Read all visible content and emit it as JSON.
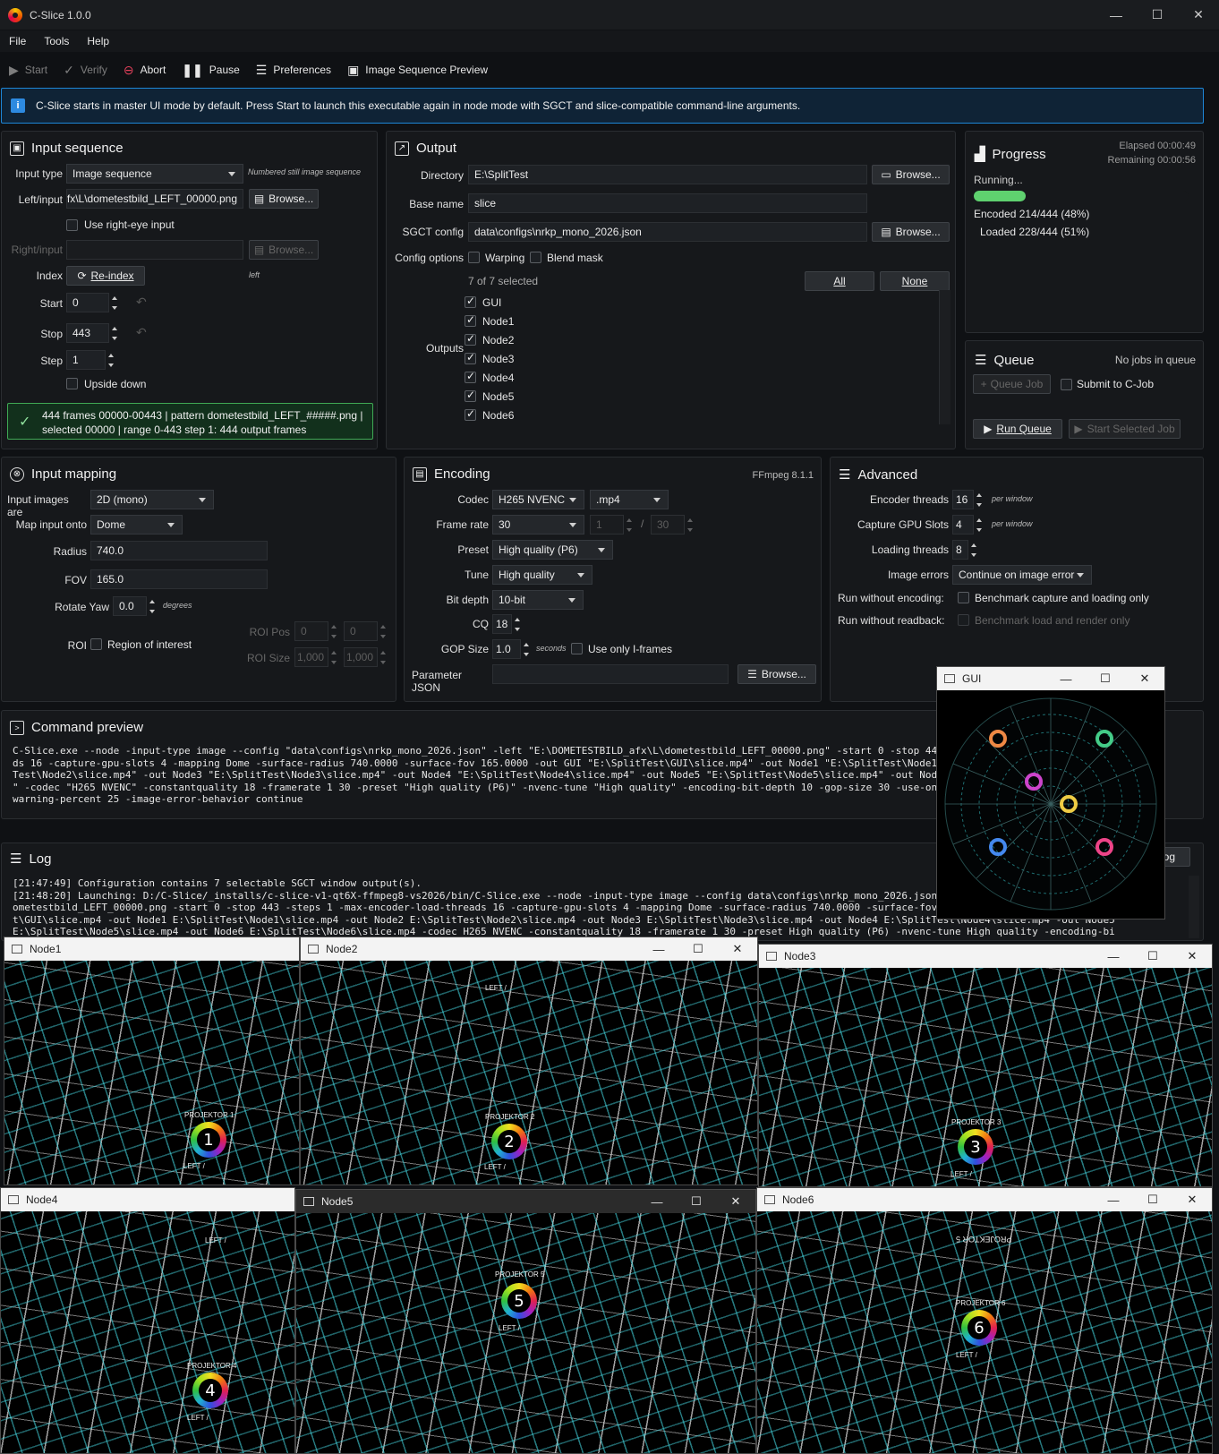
{
  "app": {
    "title": "C-Slice 1.0.0"
  },
  "menu": [
    "File",
    "Tools",
    "Help"
  ],
  "toolbar": {
    "start": "Start",
    "verify": "Verify",
    "abort": "Abort",
    "pause": "Pause",
    "preferences": "Preferences",
    "preview": "Image Sequence Preview"
  },
  "info": "C-Slice starts in master UI mode by default. Press Start to launch this executable again in node mode with SGCT and slice-compatible command-line arguments.",
  "input": {
    "title": "Input sequence",
    "input_type_label": "Input type",
    "input_type": "Image sequence",
    "input_type_hint": "Numbered still image sequence",
    "left_label": "Left/input",
    "left_value": "afx\\L\\dometestbild_LEFT_00000.png",
    "browse": "Browse...",
    "use_right_eye": "Use right-eye input",
    "right_label": "Right/input",
    "index_label": "Index",
    "reindex": "Re-index",
    "index_hint": "left",
    "start_label": "Start",
    "start_value": "0",
    "stop_label": "Stop",
    "stop_value": "443",
    "step_label": "Step",
    "step_value": "1",
    "upside_down": "Upside down",
    "status_line1": "444 frames 00000-00443 | pattern dometestbild_LEFT_#####.png |",
    "status_line2": "selected 00000 | range 0-443 step 1: 444 output frames"
  },
  "output": {
    "title": "Output",
    "directory_label": "Directory",
    "directory": "E:\\SplitTest",
    "basename_label": "Base name",
    "basename": "slice",
    "sgct_label": "SGCT config",
    "sgct": "data\\configs\\nrkp_mono_2026.json",
    "browse": "Browse...",
    "config_options_label": "Config options",
    "warping": "Warping",
    "blend_mask": "Blend mask",
    "selected_count": "7 of 7 selected",
    "all": "All",
    "none": "None",
    "outputs_label": "Outputs",
    "outputs": [
      "GUI",
      "Node1",
      "Node2",
      "Node3",
      "Node4",
      "Node5",
      "Node6"
    ]
  },
  "progress": {
    "title": "Progress",
    "elapsed": "Elapsed 00:00:49",
    "remaining": "Remaining 00:00:56",
    "status": "Running...",
    "percent": 48,
    "encoded": "Encoded 214/444 (48%)",
    "loaded": "Loaded 228/444 (51%)",
    "bar_color": "#5fd16f"
  },
  "queue": {
    "title": "Queue",
    "status": "No jobs in queue",
    "queue_job": "Queue Job",
    "submit": "Submit to C-Job",
    "run": "Run Queue",
    "start_selected": "Start Selected Job"
  },
  "mapping": {
    "title": "Input mapping",
    "images_label": "Input images are",
    "images": "2D (mono)",
    "map_label": "Map input onto",
    "map": "Dome",
    "radius_label": "Radius",
    "radius": "740.0",
    "fov_label": "FOV",
    "fov": "165.0",
    "yaw_label": "Rotate Yaw",
    "yaw": "0.0",
    "yaw_unit": "degrees",
    "roi_label": "ROI",
    "roi_check": "Region of interest",
    "roi_pos_label": "ROI Pos",
    "roi_pos_x": "0",
    "roi_pos_y": "0",
    "roi_size_label": "ROI Size",
    "roi_size_w": "1,000",
    "roi_size_h": "1,000"
  },
  "encoding": {
    "title": "Encoding",
    "version": "FFmpeg 8.1.1",
    "codec_label": "Codec",
    "codec": "H265 NVENC",
    "container": ".mp4",
    "framerate_label": "Frame rate",
    "framerate": "30",
    "fr_num": "1",
    "fr_sep": "/",
    "fr_den": "30",
    "preset_label": "Preset",
    "preset": "High quality (P6)",
    "tune_label": "Tune",
    "tune": "High quality",
    "bitdepth_label": "Bit depth",
    "bitdepth": "10-bit",
    "cq_label": "CQ",
    "cq": "18",
    "gop_label": "GOP Size",
    "gop": "1.0",
    "gop_unit": "seconds",
    "iframes": "Use only I-frames",
    "param_label": "Parameter JSON",
    "browse": "Browse..."
  },
  "advanced": {
    "title": "Advanced",
    "enc_threads_label": "Encoder threads",
    "enc_threads": "16",
    "per_window": "per window",
    "gpu_label": "Capture GPU Slots",
    "gpu": "4",
    "load_label": "Loading threads",
    "load": "8",
    "errors_label": "Image errors",
    "errors": "Continue on image error",
    "no_enc_label": "Run without encoding:",
    "no_enc": "Benchmark capture and loading only",
    "no_read_label": "Run without readback:",
    "no_read": "Benchmark load and render only"
  },
  "command": {
    "title": "Command preview",
    "lines": [
      "C-Slice.exe --node -input-type image --config \"data\\configs\\nrkp_mono_2026.json\" -left \"E:\\DOMETESTBILD_afx\\L\\dometestbild_LEFT_00000.png\" -start 0 -stop 443 -steps 1 -max-encoder-load-threa",
      "ds 16 -capture-gpu-slots 4 -mapping Dome -surface-radius 740.0000 -surface-fov 165.0000 -out GUI \"E:\\SplitTest\\GUI\\slice.mp4\" -out Node1 \"E:\\SplitTest\\Node1\\slice.mp4\" -out Node2 \"E:\\Split",
      "Test\\Node2\\slice.mp4\" -out Node3 \"E:\\SplitTest\\Node3\\slice.mp4\" -out Node4 \"E:\\SplitTest\\Node4\\slice.mp4\" -out Node5 \"E:\\SplitTest\\Node5\\slice.mp4\" -out Node6 \"E:\\SplitTest\\Node6\\slice.mp4",
      "\" -codec \"H265 NVENC\" -constantquality 18 -framerate 1 30 -preset \"High quality (P6)\" -nvenc-tune \"High quality\" -encoding-bit-depth 10 -gop-size 30 -use-only-iframes 0 -memory-size-",
      "warning-percent 25 -image-error-behavior continue"
    ]
  },
  "log": {
    "title": "Log",
    "button": "Log",
    "lines": [
      "[21:47:49] Configuration contains 7 selectable SGCT window output(s).",
      "[21:48:20] Launching: D:/C-Slice/_installs/c-slice-v1-qt6X-ffmpeg8-vs2026/bin/C-Slice.exe --node -input-type image --config data\\configs\\nrkp_mono_2026.json -left E:\\DOMETESTBILD_afx\\L\\d",
      "ometestbild_LEFT_00000.png -start 0 -stop 443 -steps 1 -max-encoder-load-threads 16 -capture-gpu-slots 4 -mapping Dome -surface-radius 740.0000 -surface-fov 165.0000 -out GUI E:\\SplitTes",
      "t\\GUI\\slice.mp4 -out Node1 E:\\SplitTest\\Node1\\slice.mp4 -out Node2 E:\\SplitTest\\Node2\\slice.mp4 -out Node3 E:\\SplitTest\\Node3\\slice.mp4 -out Node4 E:\\SplitTest\\Node4\\slice.mp4 -out Node5",
      "E:\\SplitTest\\Node5\\slice.mp4 -out Node6 E:\\SplitTest\\Node6\\slice.mp4 -codec H265 NVENC -constantquality 18 -framerate 1 30 -preset High quality (P6) -nvenc-tune High quality -encoding-bi"
    ]
  },
  "windows": {
    "gui": "GUI",
    "node1": "Node1",
    "node2": "Node2",
    "node3": "Node3",
    "node4": "Node4",
    "node5": "Node5",
    "node6": "Node6",
    "proj1": "PROJEKTOR 1",
    "proj2": "PROJEKTOR 2",
    "proj3": "PROJEKTOR 3",
    "proj4": "PROJEKTOR 4",
    "proj5": "PROJEKTOR 5",
    "proj6": "PROJEKTOR 6",
    "left": "LEFT /",
    "n1": "1",
    "n2": "2",
    "n3": "3",
    "n4": "4",
    "n5": "5",
    "n6": "6"
  },
  "icons": {
    "start": "play-icon",
    "verify": "check-icon",
    "abort": "stop-circle-icon",
    "pause": "pause-icon",
    "preferences": "sliders-icon",
    "preview": "image-icon"
  }
}
